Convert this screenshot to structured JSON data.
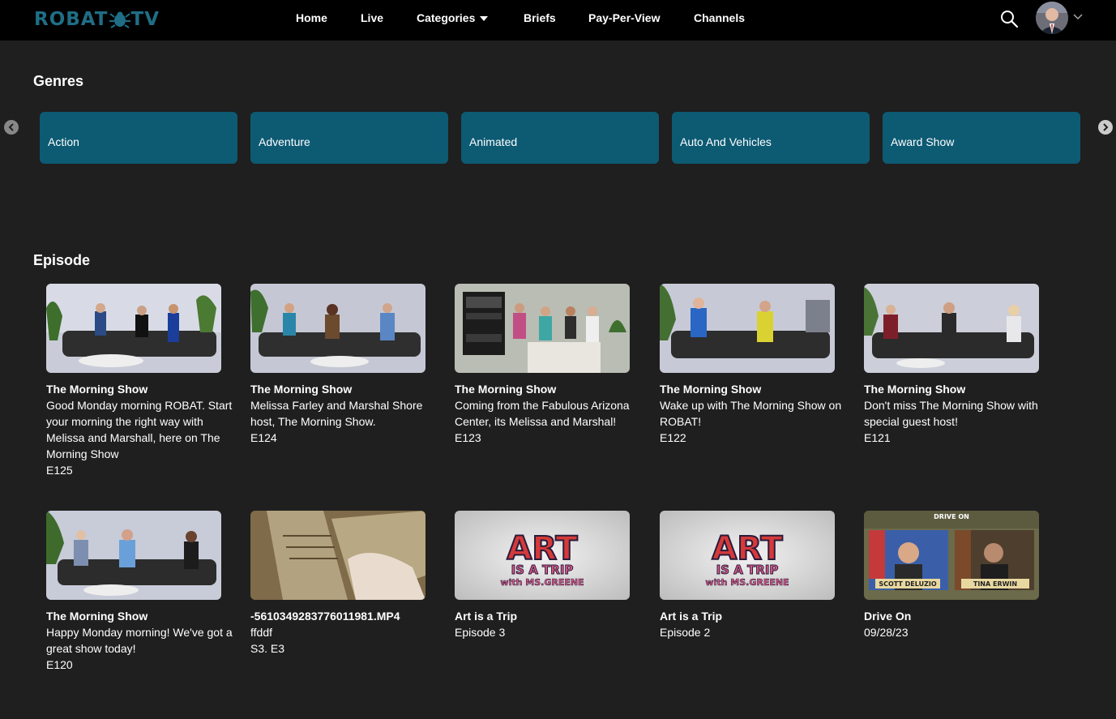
{
  "header": {
    "logo_text_left": "ROBAT",
    "logo_text_right": "TV",
    "nav": [
      {
        "label": "Home"
      },
      {
        "label": "Live"
      },
      {
        "label": "Categories"
      },
      {
        "label": "Briefs"
      },
      {
        "label": "Pay-Per-View"
      },
      {
        "label": "Channels"
      }
    ],
    "icons": {
      "search": "search-icon",
      "profile": "avatar",
      "menu": "chevron-down-icon"
    }
  },
  "genres": {
    "title": "Genres",
    "items": [
      {
        "label": "Action"
      },
      {
        "label": "Adventure"
      },
      {
        "label": "Animated"
      },
      {
        "label": "Auto And Vehicles"
      },
      {
        "label": "Award Show"
      }
    ]
  },
  "episodes": {
    "title": "Episode",
    "items": [
      {
        "title": "The Morning Show",
        "desc": "Good Monday morning ROBAT. Start your morning the right way with Melissa and Marshall, here on The Morning Show",
        "meta": "E125"
      },
      {
        "title": "The Morning Show",
        "desc": "Melissa Farley and Marshal Shore host, The Morning Show.",
        "meta": "E124"
      },
      {
        "title": "The Morning Show",
        "desc": "Coming from the Fabulous Arizona Center, its Melissa and Marshal!",
        "meta": "E123"
      },
      {
        "title": "The Morning Show",
        "desc": "Wake up with The Morning Show on ROBAT!",
        "meta": "E122"
      },
      {
        "title": "The Morning Show",
        "desc": "Don't miss The Morning Show with special guest host!",
        "meta": "E121"
      },
      {
        "title": "The Morning Show",
        "desc": "Happy Monday morning! We've got a great show today!",
        "meta": "E120"
      },
      {
        "title": "-5610349283776011981.MP4",
        "desc": "ffddf",
        "meta": "S3. E3"
      },
      {
        "title": "Art is a Trip",
        "desc": "",
        "meta": "Episode 3"
      },
      {
        "title": "Art is a Trip",
        "desc": "",
        "meta": "Episode 2"
      },
      {
        "title": "Drive On",
        "desc": "",
        "meta": "09/28/23"
      }
    ],
    "thumb_text": {
      "art_line1": "ART",
      "art_line2": "IS A TRIP",
      "art_line3": "with MS.GREENE",
      "drive_on": "DRIVE ON",
      "guest_left": "SCOTT DELUZIO",
      "guest_right": "TINA ERWIN"
    }
  },
  "colors": {
    "background": "#1f1f1f",
    "header": "#000000",
    "genre_card": "#0d5a73",
    "logo": "#1f6e86"
  }
}
